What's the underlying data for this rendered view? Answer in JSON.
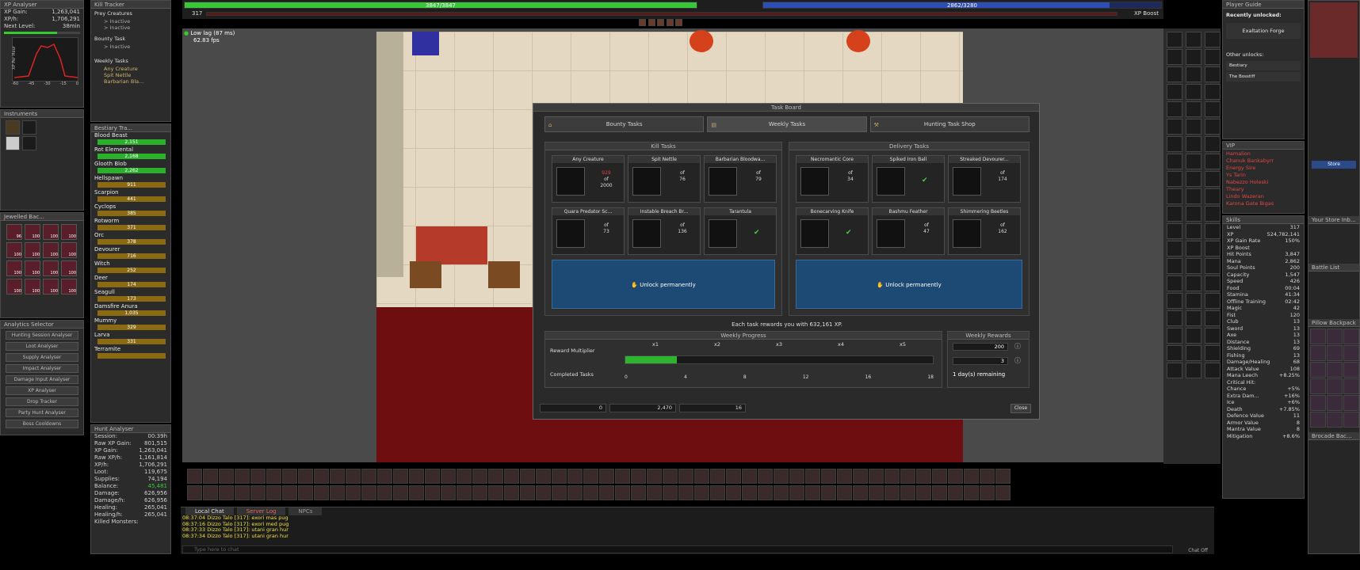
{
  "xp_analyser": {
    "title": "XP Analyser",
    "xp_gain_label": "XP Gain:",
    "xp_gain": "1,263,041",
    "xp_h_label": "XP/h:",
    "xp_h": "1,706,291",
    "next_level_label": "Next Level:",
    "next_level": "38min",
    "chart_ylabel": "XP Per Hour",
    "chart_xlabel": "Minutes",
    "chart_xticks": [
      "-60",
      "-45",
      "-30",
      "-15",
      "0"
    ]
  },
  "instruments": {
    "title": "Instruments"
  },
  "jewelled": {
    "title": "Jewelled Bac...",
    "counts": [
      "96",
      "100",
      "100",
      "100",
      "100",
      "100",
      "100",
      "100",
      "100",
      "100",
      "100",
      "100",
      "100",
      "100",
      "100",
      "100"
    ]
  },
  "analytics": {
    "title": "Analytics Selector",
    "items": [
      "Hunting Session Analyser",
      "Loot Analyser",
      "Supply Analyser",
      "Impact Analyser",
      "Damage Input Analyser",
      "XP Analyser",
      "Drop Tracker",
      "Party Hunt Analyser",
      "Boss Cooldowns"
    ]
  },
  "kill_tracker": {
    "title": "Kill Tracker",
    "prey_label": "Prey Creatures",
    "prey_items": [
      "> Inactive",
      "> Inactive"
    ],
    "bounty_label": "Bounty Task",
    "bounty_items": [
      "> Inactive"
    ],
    "weekly_label": "Weekly Tasks",
    "weekly_items": [
      "Any Creature",
      "Spit Nettle",
      "Barbarian Bla..."
    ]
  },
  "bestiary": {
    "title": "Bestiary Tra...",
    "items": [
      {
        "name": "Blood Beast",
        "value": "2,151",
        "green": true
      },
      {
        "name": "Rot Elemental",
        "value": "2,168",
        "green": true
      },
      {
        "name": "Glooth Blob",
        "value": "2,262",
        "green": true
      },
      {
        "name": "Hellspawn",
        "value": "911",
        "green": false
      },
      {
        "name": "Scarpion",
        "value": "441",
        "green": false
      },
      {
        "name": "Cyclops",
        "value": "385",
        "green": false
      },
      {
        "name": "Rotworm",
        "value": "371",
        "green": false
      },
      {
        "name": "Orc",
        "value": "378",
        "green": false
      },
      {
        "name": "Devourer",
        "value": "716",
        "green": false
      },
      {
        "name": "Witch",
        "value": "252",
        "green": false
      },
      {
        "name": "Deer",
        "value": "174",
        "green": false
      },
      {
        "name": "Seagull",
        "value": "173",
        "green": false
      },
      {
        "name": "Damsfire Anura",
        "value": "1,035",
        "green": false
      },
      {
        "name": "Mummy",
        "value": "329",
        "green": false
      },
      {
        "name": "Larva",
        "value": "331",
        "green": false
      },
      {
        "name": "Terramite",
        "value": "",
        "green": false
      }
    ]
  },
  "hunt_analyser": {
    "title": "Hunt Analyser",
    "rows": [
      {
        "label": "Session:",
        "value": "00:39h"
      },
      {
        "label": "Raw XP Gain:",
        "value": "801,515"
      },
      {
        "label": "XP Gain:",
        "value": "1,263,041"
      },
      {
        "label": "Raw XP/h:",
        "value": "1,161,814"
      },
      {
        "label": "XP/h:",
        "value": "1,706,291"
      },
      {
        "label": "Loot:",
        "value": "119,675"
      },
      {
        "label": "Supplies:",
        "value": "74,194"
      },
      {
        "label": "Balance:",
        "value": "45,481"
      },
      {
        "label": "Damage:",
        "value": "626,956"
      },
      {
        "label": "Damage/h:",
        "value": "626,956"
      },
      {
        "label": "Healing:",
        "value": "265,041"
      },
      {
        "label": "Healing/h:",
        "value": "265,041"
      },
      {
        "label": "Killed Monsters:",
        "value": ""
      }
    ]
  },
  "status": {
    "hp": "3847/3847",
    "mana": "2862/3280",
    "level": "317",
    "xp_boost": "XP Boost",
    "hp_pct": 100,
    "mana_pct": 87
  },
  "fps": {
    "lag": "Low lag (87 ms)",
    "fps": "62.83 fps"
  },
  "task_board": {
    "title": "Task Board",
    "tabs": [
      "Bounty Tasks",
      "Weekly Tasks",
      "Hunting Task Shop"
    ],
    "kill_header": "Kill Tasks",
    "delivery_header": "Delivery Tasks",
    "kill_tasks": [
      {
        "name": "Any Creature",
        "top": "929",
        "of": "of",
        "total": "2000",
        "done": false
      },
      {
        "name": "Spit Nettle",
        "top": "",
        "of": "of",
        "total": "76",
        "done": false
      },
      {
        "name": "Barbarian Bloodwa...",
        "top": "",
        "of": "of",
        "total": "79",
        "done": false
      },
      {
        "name": "Quara Predator Sc...",
        "top": "",
        "of": "of",
        "total": "73",
        "done": false
      },
      {
        "name": "Instable Breach Br...",
        "top": "",
        "of": "of",
        "total": "136",
        "done": false
      },
      {
        "name": "Tarantula",
        "top": "",
        "of": "",
        "total": "",
        "done": true
      }
    ],
    "delivery_tasks": [
      {
        "name": "Necromantic Core",
        "top": "",
        "of": "of",
        "total": "34",
        "done": false
      },
      {
        "name": "Spiked Iron Ball",
        "top": "",
        "of": "",
        "total": "",
        "done": true
      },
      {
        "name": "Streaked Devourer...",
        "top": "",
        "of": "of",
        "total": "174",
        "done": false
      },
      {
        "name": "Bonecarving Knife",
        "top": "",
        "of": "",
        "total": "",
        "done": true
      },
      {
        "name": "Bashmu Feather",
        "top": "",
        "of": "of",
        "total": "47",
        "done": false
      },
      {
        "name": "Shimmering Beetles",
        "top": "",
        "of": "of",
        "total": "162",
        "done": false
      }
    ],
    "unlock_label": "Unlock permanently",
    "reward_text": "Each task rewards you with 632,161 XP.",
    "progress_title": "Weekly Progress",
    "multiplier_label": "Reward Multiplier",
    "multipliers": [
      "x1",
      "x2",
      "x3",
      "x4",
      "x5"
    ],
    "completed_label": "Completed Tasks",
    "completed_ticks": [
      "0",
      "4",
      "8",
      "12",
      "16",
      "18"
    ],
    "completed_count": 3,
    "completed_max": 18,
    "rewards_title": "Weekly Rewards",
    "reward_value_1": "200",
    "reward_value_2": "3",
    "days_remaining": "1 day(s) remaining",
    "bottom_values": [
      "0",
      "2,470",
      "16"
    ],
    "close_label": "Close"
  },
  "chat": {
    "tabs": [
      "Local Chat",
      "Server Log",
      "NPCs"
    ],
    "lines": [
      "08:37:04 Dizzo Talo [317]: exori mas pug",
      "08:37:16 Dizzo Talo [317]: exori med pug",
      "08:37:33 Dizzo Talo [317]: utani gran hur",
      "08:37:34 Dizzo Talo [317]: utani gran hur"
    ],
    "placeholder": "Type here to chat",
    "close_label": "Chat Off"
  },
  "player_guide": {
    "title": "Player Guide",
    "recently_unlocked": "Recently unlocked:",
    "exaltation": "Exaltation Forge",
    "other_unlocks": "Other unlocks:",
    "items": [
      "Bestiary",
      "The Bosstiff"
    ]
  },
  "vip": {
    "title": "VIP",
    "names": [
      "Hamalion",
      "Chanuk Bankabyrr",
      "Energy Sire",
      "Ys Tarin",
      "Nabezzo Holeski",
      "Theary",
      "Lindo Wazeran",
      "Karona Gate Bigas"
    ]
  },
  "skills": {
    "title": "Skills",
    "rows": [
      {
        "label": "Level",
        "value": "317"
      },
      {
        "label": "XP",
        "value": "524,782,141"
      },
      {
        "label": "XP Gain Rate",
        "value": "150%"
      },
      {
        "label": "XP Boost",
        "value": ""
      },
      {
        "label": "Hit Points",
        "value": "3,847"
      },
      {
        "label": "Mana",
        "value": "2,862"
      },
      {
        "label": "Soul Points",
        "value": "200"
      },
      {
        "label": "Capacity",
        "value": "1,547"
      },
      {
        "label": "Speed",
        "value": "426"
      },
      {
        "label": "Food",
        "value": "00:04"
      },
      {
        "label": "Stamina",
        "value": "41:34"
      },
      {
        "label": "Offline Training",
        "value": "02:42"
      },
      {
        "label": "Magic",
        "value": "42"
      },
      {
        "label": "Fist",
        "value": "120"
      },
      {
        "label": "Club",
        "value": "13"
      },
      {
        "label": "Sword",
        "value": "13"
      },
      {
        "label": "Axe",
        "value": "13"
      },
      {
        "label": "Distance",
        "value": "13"
      },
      {
        "label": "Shielding",
        "value": "69"
      },
      {
        "label": "Fishing",
        "value": "13"
      },
      {
        "label": "Damage/Healing",
        "value": "68"
      },
      {
        "label": "Attack Value",
        "value": "108"
      },
      {
        "label": "Mana Leech",
        "value": "+8.25%"
      },
      {
        "label": "Critical Hit:",
        "value": ""
      },
      {
        "label": "Chance",
        "value": "+5%"
      },
      {
        "label": "Extra Dam...",
        "value": "+16%"
      },
      {
        "label": "Ice",
        "value": "+6%"
      },
      {
        "label": "Death",
        "value": "+7.85%"
      },
      {
        "label": "Defence Value",
        "value": "11"
      },
      {
        "label": "Armor Value",
        "value": "8"
      },
      {
        "label": "Mantra Value",
        "value": "8"
      },
      {
        "label": "Mitigation",
        "value": "+8.6%"
      }
    ]
  },
  "right_far": {
    "store": "Store",
    "your_store": "Your Store Inb...",
    "battle": "Battle List",
    "backpack": "Pillow Backpack",
    "brocade": "Brocade Bac..."
  }
}
